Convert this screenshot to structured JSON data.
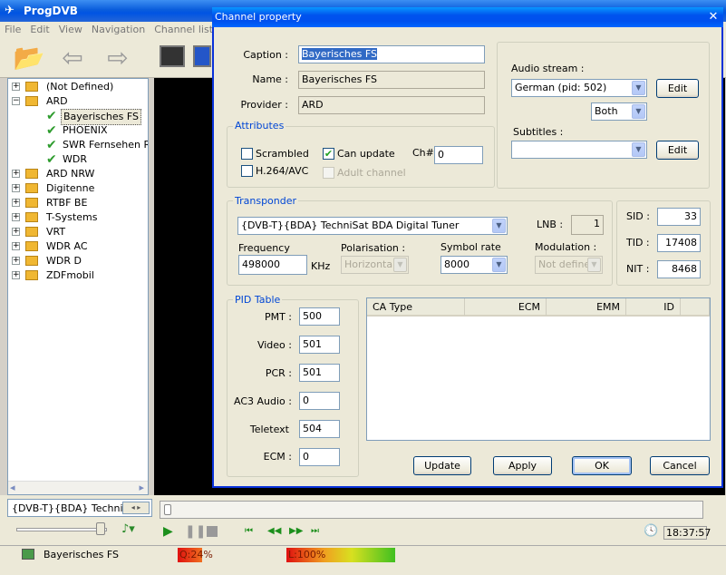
{
  "app": {
    "title": "ProgDVB",
    "menu": [
      "File",
      "Edit",
      "View",
      "Navigation",
      "Channel list"
    ]
  },
  "tree": {
    "items": [
      {
        "label": "(Not Defined)",
        "level": 0,
        "expander": "+",
        "icon": "folder-icon"
      },
      {
        "label": "ARD",
        "level": 0,
        "expander": "−",
        "icon": "folder-icon"
      },
      {
        "label": "Bayerisches FS",
        "level": 1,
        "icon": "check-icon",
        "selected": true
      },
      {
        "label": "PHOENIX",
        "level": 1,
        "icon": "check-icon"
      },
      {
        "label": "SWR Fernsehen RP",
        "level": 1,
        "icon": "check-icon"
      },
      {
        "label": "WDR",
        "level": 1,
        "icon": "check-icon"
      },
      {
        "label": "ARD NRW",
        "level": 0,
        "expander": "+",
        "icon": "folder-icon"
      },
      {
        "label": "Digitenne",
        "level": 0,
        "expander": "+",
        "icon": "folder-icon"
      },
      {
        "label": "RTBF BE",
        "level": 0,
        "expander": "+",
        "icon": "folder-icon"
      },
      {
        "label": "T-Systems",
        "level": 0,
        "expander": "+",
        "icon": "folder-icon"
      },
      {
        "label": "VRT",
        "level": 0,
        "expander": "+",
        "icon": "folder-icon"
      },
      {
        "label": "WDR AC",
        "level": 0,
        "expander": "+",
        "icon": "folder-icon"
      },
      {
        "label": "WDR D",
        "level": 0,
        "expander": "+",
        "icon": "folder-icon"
      },
      {
        "label": "ZDFmobil",
        "level": 0,
        "expander": "+",
        "icon": "folder-icon"
      }
    ]
  },
  "bottom": {
    "tuner_label": "{DVB-T}{BDA} TechniS",
    "time": "18:37:57",
    "channel": "Bayerisches FS",
    "quality": "Q:24%",
    "quality_value": 0.24,
    "level": "L:100%",
    "level_value": 1.0
  },
  "dialog": {
    "title": "Channel property",
    "caption_label": "Caption :",
    "caption_value": "Bayerisches FS",
    "name_label": "Name :",
    "name_value": "Bayerisches FS",
    "provider_label": "Provider :",
    "provider_value": "ARD",
    "audio_stream_label": "Audio stream :",
    "audio_stream_value": "German  (pid: 502)",
    "audio_mode_value": "Both",
    "edit_label": "Edit",
    "subtitles_label": "Subtitles :",
    "subtitles_value": "",
    "attributes": {
      "legend": "Attributes",
      "scrambled": "Scrambled",
      "can_update": "Can update",
      "ch_label": "Ch#",
      "ch_value": "0",
      "h264": "H.264/AVC",
      "adult": "Adult channel"
    },
    "transponder": {
      "legend": "Transponder",
      "device": "{DVB-T}{BDA} TechniSat BDA Digital Tuner",
      "lnb_label": "LNB :",
      "lnb_value": "1",
      "frequency_label": "Frequency",
      "frequency_value": "498000",
      "frequency_unit": "KHz",
      "polarisation_label": "Polarisation :",
      "polarisation_value": "Horizontal",
      "symbol_rate_label": "Symbol rate",
      "symbol_rate_value": "8000",
      "modulation_label": "Modulation :",
      "modulation_value": "Not defined",
      "sid_label": "SID :",
      "sid_value": "33",
      "tid_label": "TID :",
      "tid_value": "17408",
      "nit_label": "NIT :",
      "nit_value": "8468"
    },
    "pid": {
      "legend": "PID Table",
      "pmt_label": "PMT :",
      "pmt_value": "500",
      "video_label": "Video :",
      "video_value": "501",
      "pcr_label": "PCR :",
      "pcr_value": "501",
      "ac3_label": "AC3 Audio :",
      "ac3_value": "0",
      "teletext_label": "Teletext",
      "teletext_value": "504",
      "ecm_label": "ECM :",
      "ecm_value": "0"
    },
    "ca_columns": [
      "CA Type",
      "ECM",
      "EMM",
      "ID"
    ],
    "buttons": {
      "update": "Update",
      "apply": "Apply",
      "ok": "OK",
      "cancel": "Cancel"
    }
  }
}
